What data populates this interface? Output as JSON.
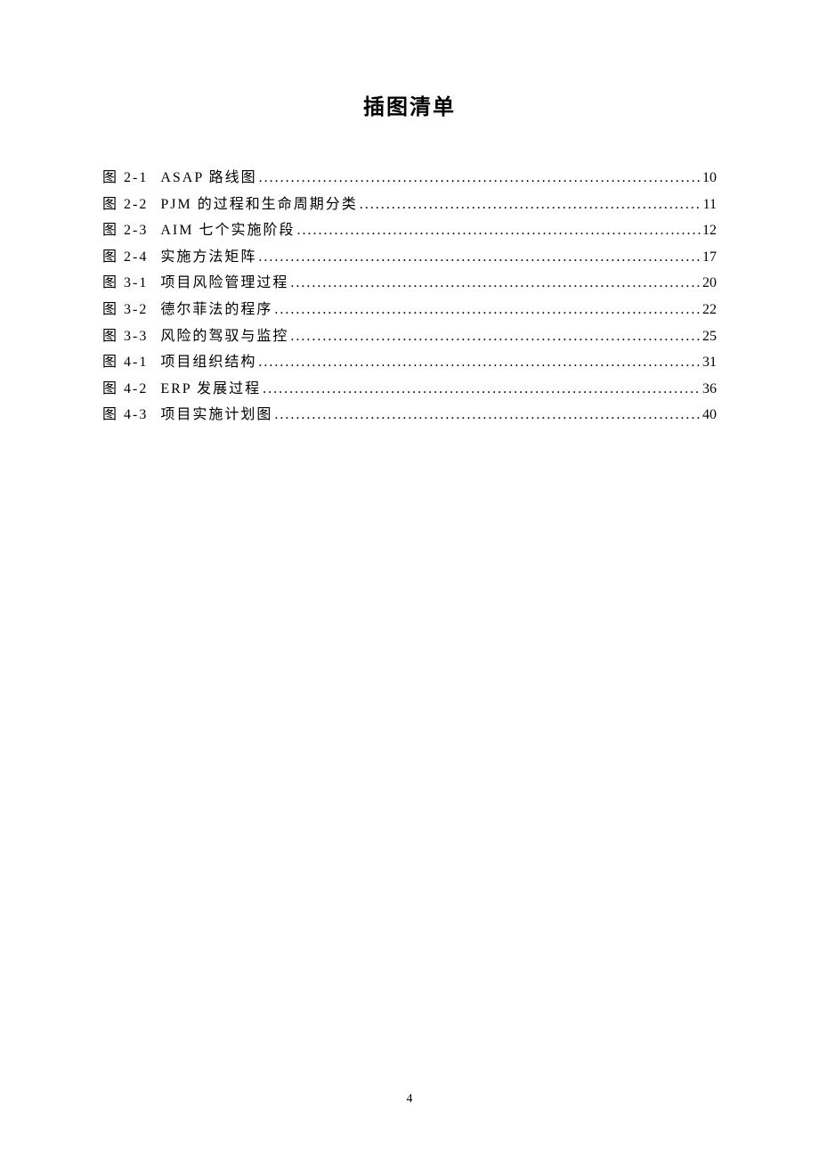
{
  "title": "插图清单",
  "entries": [
    {
      "label": "图 2-1",
      "text": "ASAP 路线图",
      "page": "10"
    },
    {
      "label": "图 2-2",
      "text": "PJM 的过程和生命周期分类",
      "page": "11"
    },
    {
      "label": "图 2-3",
      "text": "AIM 七个实施阶段",
      "page": "12"
    },
    {
      "label": "图 2-4",
      "text": "实施方法矩阵",
      "page": "17"
    },
    {
      "label": "图 3-1",
      "text": "项目风险管理过程",
      "page": "20"
    },
    {
      "label": "图 3-2",
      "text": "德尔菲法的程序",
      "page": "22"
    },
    {
      "label": "图 3-3",
      "text": "风险的驾驭与监控",
      "page": "25"
    },
    {
      "label": "图 4-1",
      "text": "项目组织结构",
      "page": "31"
    },
    {
      "label": "图 4-2",
      "text": "ERP 发展过程",
      "page": "36"
    },
    {
      "label": "图 4-3",
      "text": "项目实施计划图",
      "page": "40"
    }
  ],
  "page_number": "4"
}
